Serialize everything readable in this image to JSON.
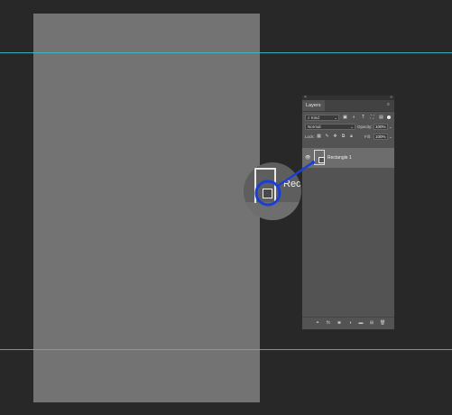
{
  "panel": {
    "title": "Layers",
    "close_glyph": "×",
    "collapse_glyph": "»",
    "menu_glyph": "≡"
  },
  "filter": {
    "kind_label": "Kind",
    "icons": [
      "image-filter-icon",
      "adjustment-filter-icon",
      "type-filter-icon",
      "shape-filter-icon",
      "smart-object-filter-icon"
    ]
  },
  "blend": {
    "mode": "Normal",
    "opacity_label": "Opacity:",
    "opacity_value": "100%",
    "fill_label": "Fill:",
    "fill_value": "100%"
  },
  "lock": {
    "label": "Lock:"
  },
  "layers": [
    {
      "name": "Rectangle 1",
      "visible": true
    }
  ],
  "magnifier": {
    "text": "Rec"
  },
  "bottom_bar": {
    "icons": [
      "link-layers-icon",
      "fx-icon",
      "mask-icon",
      "adjustment-icon",
      "group-folder-icon",
      "new-layer-icon",
      "trash-icon"
    ],
    "fx_label": "fx"
  },
  "colors": {
    "background": "#282828",
    "canvas": "#737373",
    "guide": "#3fb8c6",
    "panel": "#535353",
    "selected_layer": "#6d6d6d",
    "annotation": "#1a3fd6"
  }
}
